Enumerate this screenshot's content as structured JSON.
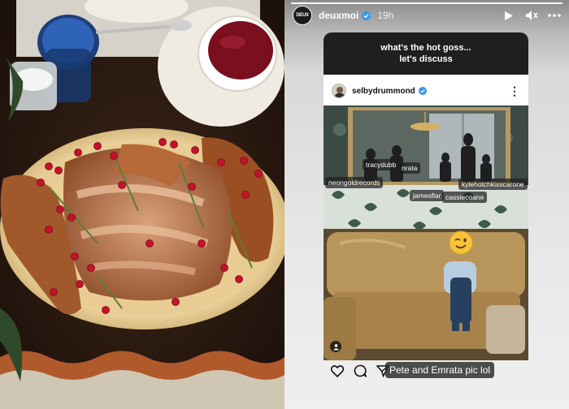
{
  "story": {
    "username": "deuxmoi",
    "time_ago": "19h",
    "avatar_text": "DEUX",
    "icons": {
      "verified": "verified-badge-icon",
      "play": "play-icon",
      "mute": "mute-icon",
      "more": "more-horizontal-icon"
    },
    "progress": 1.0
  },
  "question": {
    "line1": "what's the hot goss...",
    "line2": "let's discuss"
  },
  "post": {
    "username": "selbydrummond",
    "more_label": "⋮",
    "tags": {
      "tag1": "tracydubb",
      "tag2": "nrata",
      "tag3": "neongoldrecords",
      "tag4": "kylehotchkisscarone",
      "tag5": "jamesflar",
      "tag6": "cassiecoane"
    },
    "emoji": "winking-face-emoji"
  },
  "footer": {
    "caption": "Pete and Emrata pic lol",
    "icons": [
      "heart-icon",
      "comment-icon",
      "send-icon"
    ]
  },
  "colors": {
    "accent_verified": "#3897f0",
    "question_bg": "#1f1f1f"
  }
}
